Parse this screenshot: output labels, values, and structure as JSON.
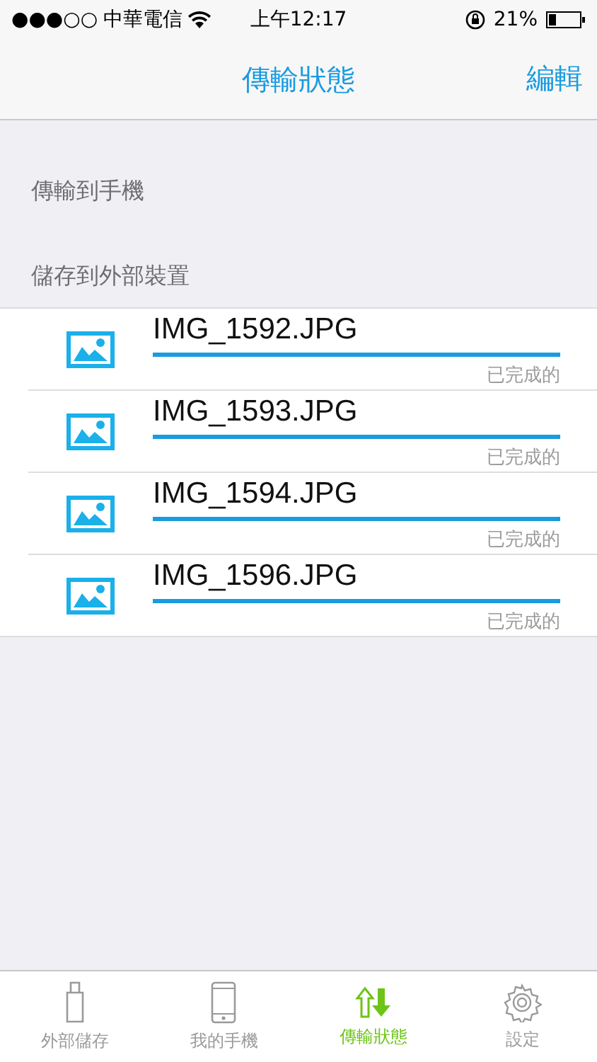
{
  "status_bar": {
    "signal": "●●●○○",
    "carrier": "中華電信",
    "time": "上午12:17",
    "battery": "21%"
  },
  "nav": {
    "title": "傳輸狀態",
    "action": "編輯"
  },
  "sections": [
    {
      "title": "傳輸到手機"
    },
    {
      "title": "儲存到外部裝置",
      "files": [
        {
          "name": "IMG_1592.JPG",
          "level": 1,
          "status": "已完成的"
        },
        {
          "name": "IMG_1593.JPG",
          "level": 1,
          "status": "已完成的"
        },
        {
          "name": "IMG_1594.JPG",
          "level": 1,
          "status": "已完成的"
        },
        {
          "name": "IMG_1596.JPG",
          "level": 1,
          "status": "已完成的"
        }
      ]
    }
  ],
  "tabs": [
    {
      "label": "外部儲存",
      "kind": "usb",
      "selected": false
    },
    {
      "label": "我的手機",
      "kind": "phone",
      "selected": false
    },
    {
      "label": "傳輸狀態",
      "kind": "transfer",
      "selected": true
    },
    {
      "label": "設定",
      "kind": "settings",
      "selected": false
    }
  ]
}
